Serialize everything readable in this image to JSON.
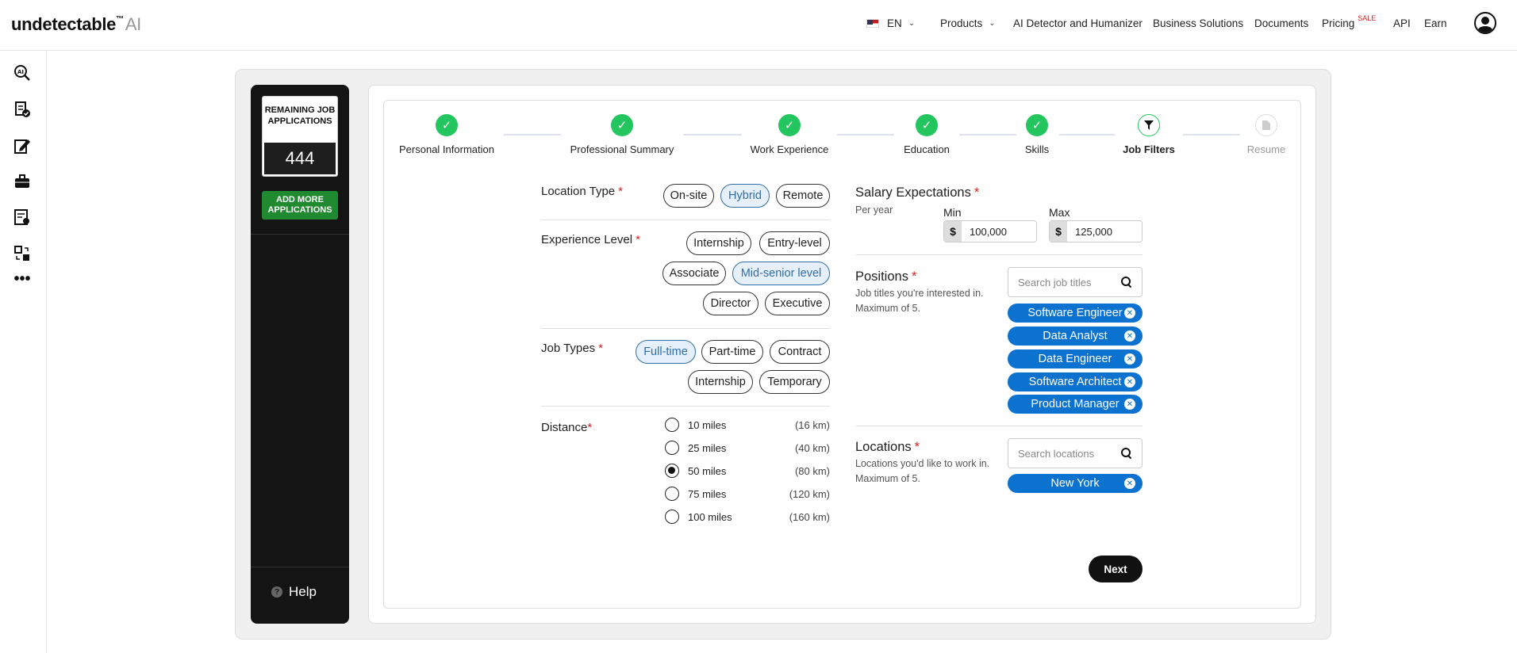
{
  "brand": {
    "name": "undetectable",
    "tm": "™",
    "ai": "AI"
  },
  "nav": {
    "lang": "EN",
    "products": "Products",
    "detector": "AI Detector and Humanizer",
    "business": "Business Solutions",
    "documents": "Documents",
    "pricing": "Pricing",
    "sale": "SALE",
    "api": "API",
    "earn": "Earn"
  },
  "rail_icons": [
    "ai-search-icon",
    "document-check-icon",
    "pen-edit-icon",
    "briefcase-icon",
    "seo-report-icon",
    "swap-icon",
    "more-icon"
  ],
  "sidebar": {
    "remaining_title": "REMAINING JOB APPLICATIONS",
    "remaining_count": "444",
    "add_more": "ADD MORE APPLICATIONS",
    "help": "Help"
  },
  "steps": [
    {
      "label": "Personal Information",
      "state": "done"
    },
    {
      "label": "Professional Summary",
      "state": "done"
    },
    {
      "label": "Work Experience",
      "state": "done"
    },
    {
      "label": "Education",
      "state": "done"
    },
    {
      "label": "Skills",
      "state": "done"
    },
    {
      "label": "Job Filters",
      "state": "current"
    },
    {
      "label": "Resume",
      "state": "todo"
    }
  ],
  "form": {
    "location_type": {
      "label": "Location Type",
      "req": "*",
      "options": [
        "On-site",
        "Hybrid",
        "Remote"
      ],
      "selected": "Hybrid"
    },
    "experience": {
      "label": "Experience Level",
      "req": "*",
      "options": [
        "Internship",
        "Entry-level",
        "Associate",
        "Mid-senior level",
        "Director",
        "Executive"
      ],
      "selected": "Mid-senior level"
    },
    "job_types": {
      "label": "Job Types",
      "req": "*",
      "options": [
        "Full-time",
        "Part-time",
        "Contract",
        "Internship",
        "Temporary"
      ],
      "selected": "Full-time"
    },
    "distance": {
      "label": "Distance",
      "req": "*",
      "options": [
        {
          "miles": "10 miles",
          "km": "(16 km)"
        },
        {
          "miles": "25 miles",
          "km": "(40 km)"
        },
        {
          "miles": "50 miles",
          "km": "(80 km)"
        },
        {
          "miles": "75 miles",
          "km": "(120 km)"
        },
        {
          "miles": "100 miles",
          "km": "(160 km)"
        }
      ],
      "selected": "50 miles"
    },
    "salary": {
      "label": "Salary Expectations",
      "req": "*",
      "sub": "Per year",
      "min_label": "Min",
      "max_label": "Max",
      "currency": "$",
      "min": "100,000",
      "max": "125,000"
    },
    "positions": {
      "label": "Positions",
      "req": "*",
      "sub": "Job titles you're interested in. Maximum of 5.",
      "placeholder": "Search job titles",
      "tags": [
        "Software Engineer",
        "Data Analyst",
        "Data Engineer",
        "Software Architect",
        "Product Manager"
      ]
    },
    "locations": {
      "label": "Locations",
      "req": "*",
      "sub": "Locations you'd like to work in. Maximum of 5.",
      "placeholder": "Search locations",
      "tags": [
        "New York"
      ]
    },
    "next": "Next"
  }
}
